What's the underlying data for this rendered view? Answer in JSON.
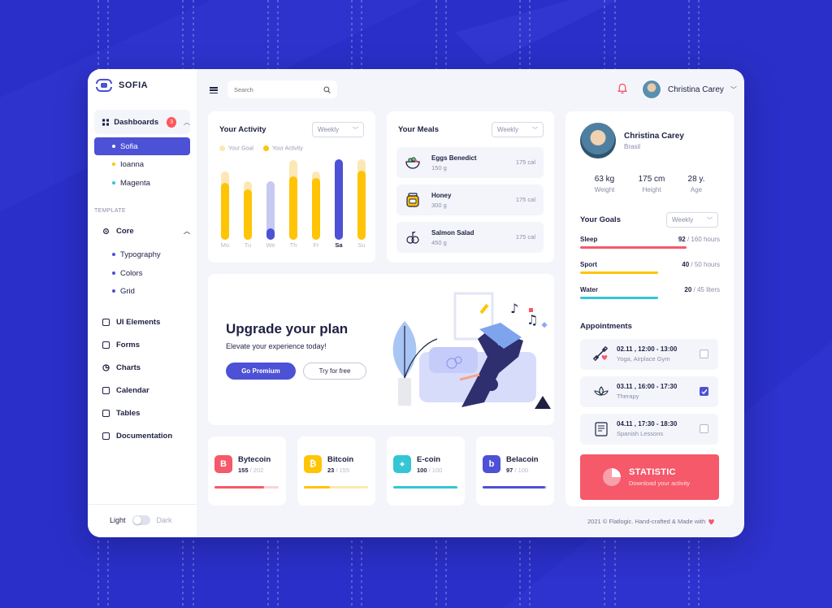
{
  "brand": {
    "name": "SOFIA"
  },
  "sidebar": {
    "group": {
      "label": "Dashboards",
      "badge": "3"
    },
    "sub_items": [
      {
        "label": "Sofia",
        "dot": "#ffffff",
        "active": true
      },
      {
        "label": "Ioanna",
        "dot": "#ffc405"
      },
      {
        "label": "Magenta",
        "dot": "#34c6d3"
      }
    ],
    "section_label": "TEMPLATE",
    "core": {
      "label": "Core",
      "items": [
        "Typography",
        "Colors",
        "Grid"
      ]
    },
    "items": [
      "UI Elements",
      "Forms",
      "Charts",
      "Calendar",
      "Tables",
      "Documentation"
    ],
    "theme": {
      "light": "Light",
      "dark": "Dark"
    }
  },
  "header": {
    "search_placeholder": "Search",
    "user_name": "Christina Carey"
  },
  "activity": {
    "title": "Your Activity",
    "period": "Weekly",
    "legend": {
      "goal": "Your Goal",
      "activity": "Your Activity"
    }
  },
  "chart_data": {
    "type": "bar",
    "categories": [
      "Mo",
      "Tu",
      "We",
      "Th",
      "Fr",
      "Sa",
      "Su"
    ],
    "active_category": "Sa",
    "series": [
      {
        "name": "Your Goal",
        "values": [
          0.84,
          0.72,
          0.72,
          0.98,
          0.84,
          0.99,
          0.99
        ]
      },
      {
        "name": "Your Activity",
        "values": [
          0.7,
          0.62,
          0.14,
          0.78,
          0.76,
          0.99,
          0.85
        ]
      }
    ],
    "colors": {
      "goal": "#fde8b5",
      "activity": "#ffc405",
      "active": "#4c51d5",
      "low_track": "#c7c9f2"
    }
  },
  "meals": {
    "title": "Your Meals",
    "period": "Weekly",
    "items": [
      {
        "name": "Eggs Benedict",
        "weight": "150 g",
        "cal": "175 cal",
        "icon": "bowl-icon"
      },
      {
        "name": "Honey",
        "weight": "300 g",
        "cal": "175 cal",
        "icon": "honey-jar-icon"
      },
      {
        "name": "Salmon Salad",
        "weight": "450 g",
        "cal": "175 cal",
        "icon": "salad-icon"
      }
    ]
  },
  "upgrade": {
    "title": "Upgrade your plan",
    "subtitle": "Elevate your experience today!",
    "primary": "Go Premium",
    "secondary": "Try for free"
  },
  "coins": [
    {
      "name": "Bytecoin",
      "value": "155",
      "total": "/ 202",
      "color": "#f5596a",
      "track": "#fcd2d6",
      "glyph": "B",
      "progress": 0.77
    },
    {
      "name": "Bitcoin",
      "value": "23",
      "total": "/ 155",
      "color": "#ffc405",
      "track": "#fdeaaa",
      "glyph": "₿",
      "progress": 0.4
    },
    {
      "name": "E-coin",
      "value": "100",
      "total": "/ 100",
      "color": "#34c6d3",
      "track": "#b8edf1",
      "glyph": "✦",
      "progress": 1.0
    },
    {
      "name": "Belacoin",
      "value": "97",
      "total": "/ 100",
      "color": "#4c51d5",
      "track": "#c7c9f2",
      "glyph": "b",
      "progress": 0.97
    }
  ],
  "profile": {
    "name": "Christina Carey",
    "country": "Brasil",
    "stats": [
      {
        "value": "63 kg",
        "label": "Weight"
      },
      {
        "value": "175 cm",
        "label": "Height"
      },
      {
        "value": "28 y.",
        "label": "Age"
      }
    ]
  },
  "goals": {
    "title": "Your Goals",
    "period": "Weekly",
    "items": [
      {
        "name": "Sleep",
        "value": "92",
        "total": "/ 160 hours",
        "color": "#f5596a",
        "progress": 0.76
      },
      {
        "name": "Sport",
        "value": "40",
        "total": "/ 50 hours",
        "color": "#ffc405",
        "progress": 0.56
      },
      {
        "name": "Water",
        "value": "20",
        "total": "/ 45 liters",
        "color": "#34c6d3",
        "progress": 0.56
      }
    ]
  },
  "appointments": {
    "title": "Appointments",
    "items": [
      {
        "time": "02.11 , 12:00 - 13:00",
        "desc": "Yoga, Airplace Gym",
        "checked": false,
        "icon": "dumbbell-heart-icon"
      },
      {
        "time": "03.11 , 16:00 - 17:30",
        "desc": "Therapy",
        "checked": true,
        "icon": "lotus-icon"
      },
      {
        "time": "04.11 , 17:30 - 18:30",
        "desc": "Spanish Lessons",
        "checked": false,
        "icon": "notebook-icon"
      }
    ]
  },
  "statistic": {
    "title": "STATISTIC",
    "subtitle": "Download your activity"
  },
  "footer": {
    "text": "2021 © Flatlogic. Hand-crafted & Made with"
  }
}
